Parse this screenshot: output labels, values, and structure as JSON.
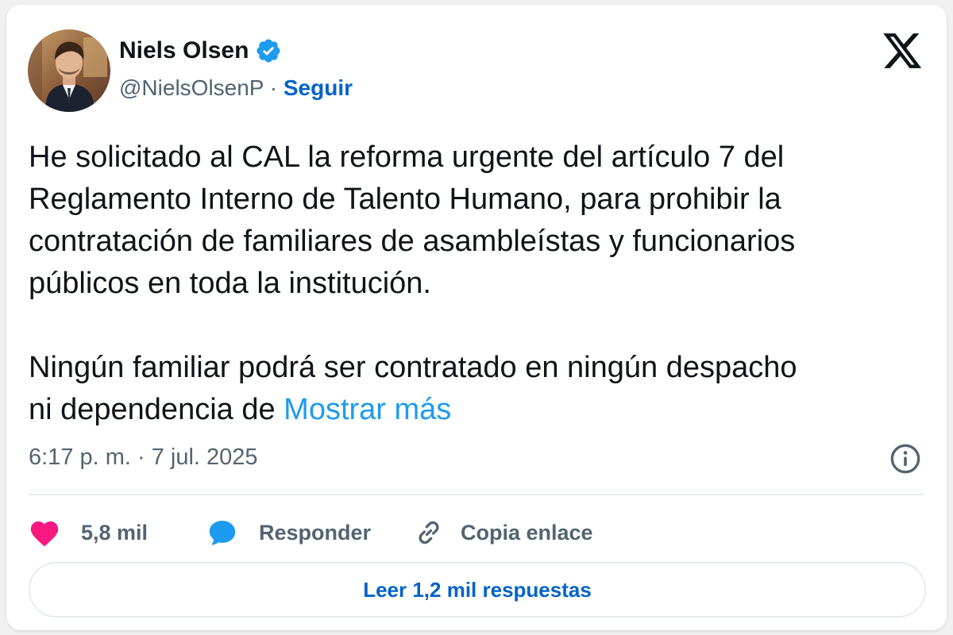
{
  "author": {
    "name": "Niels Olsen",
    "handle": "@NielsOlsenP",
    "separator": "·",
    "follow_label": "Seguir"
  },
  "tweet": {
    "paragraphs": [
      [
        "He solicitado al CAL la reforma urgente del artículo 7 del",
        "Reglamento Interno de Talento Humano, para prohibir la",
        "contratación de familiares de asambleístas y funcionarios",
        "públicos en toda la institución."
      ],
      [
        "Ningún familiar podrá ser contratado en ningún despacho",
        "ni dependencia de"
      ]
    ],
    "show_more_label": "Mostrar más",
    "timestamp": "6:17 p. m. · 7 jul. 2025"
  },
  "actions": {
    "likes": "5,8 mil",
    "reply_label": "Responder",
    "copy_link_label": "Copia enlace"
  },
  "read_replies_label": "Leer 1,2 mil respuestas",
  "icons": {
    "logo": "x-logo-icon",
    "verified": "verified-badge-icon",
    "info": "info-icon",
    "like": "heart-icon",
    "reply": "speech-bubble-icon",
    "copy": "link-icon"
  },
  "colors": {
    "link": "#1d9bf0",
    "follow": "#0063c9",
    "like": "#f91880",
    "verified": "#1d9bf0",
    "muted": "#536471"
  }
}
